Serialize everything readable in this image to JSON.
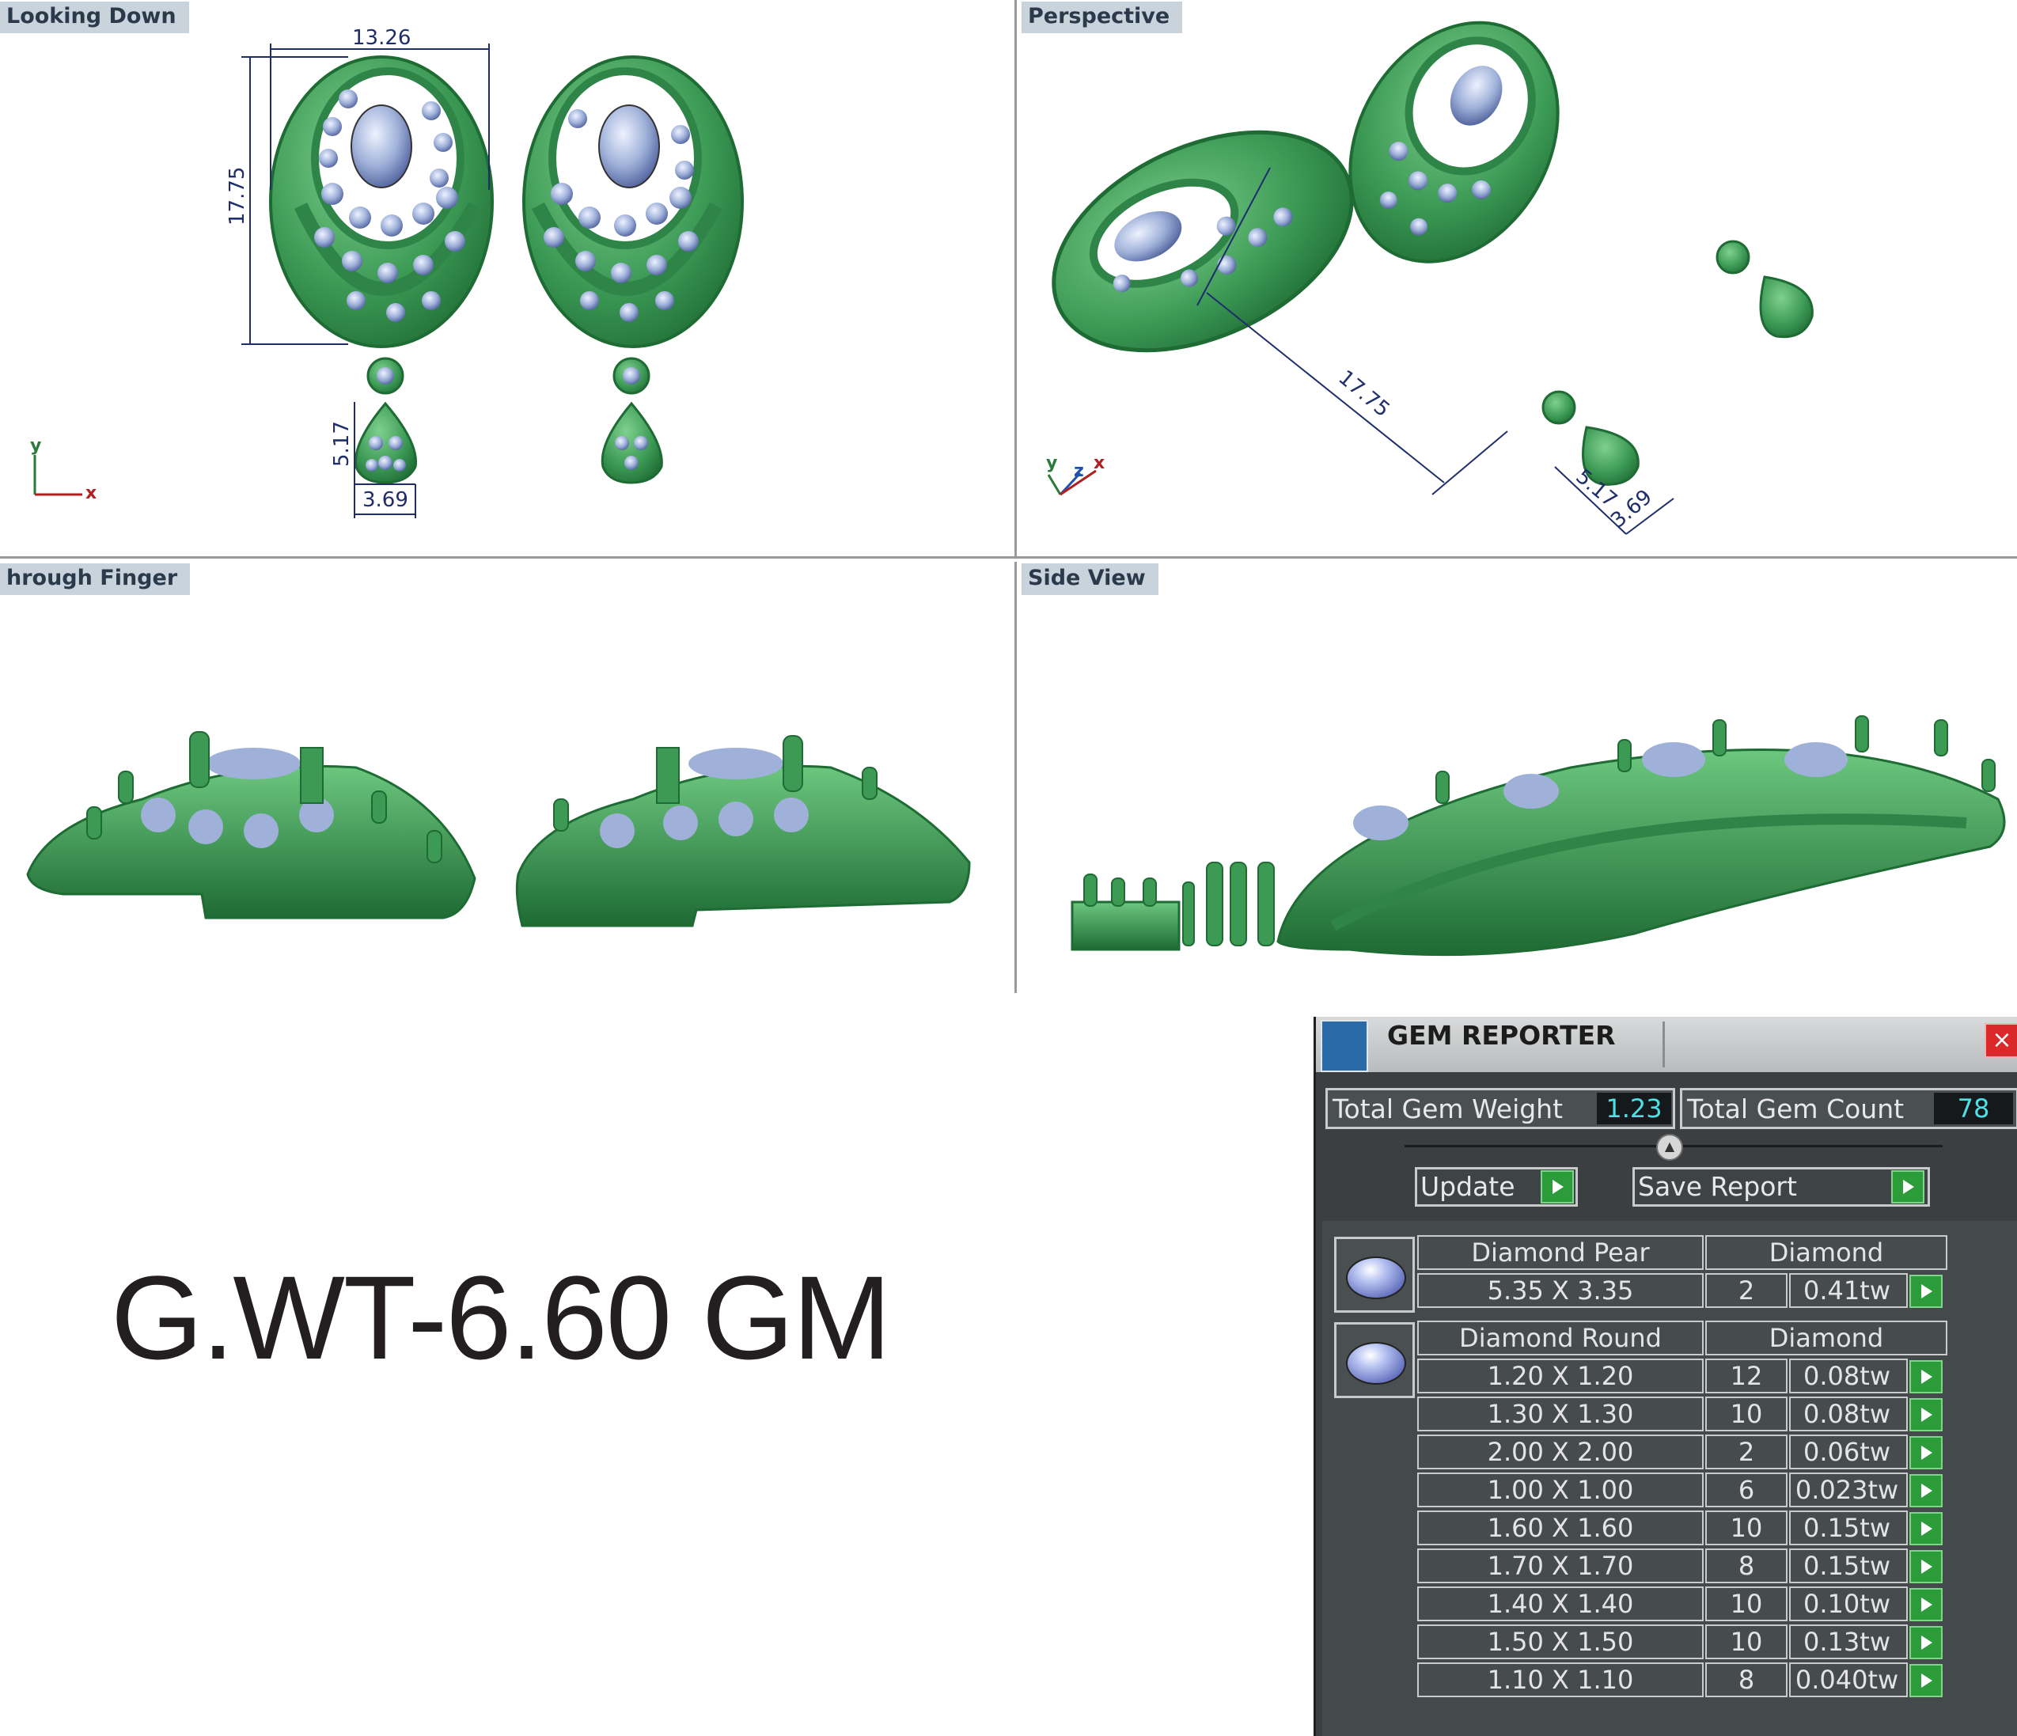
{
  "viewports": {
    "top_left": {
      "label": "Looking Down",
      "dims": {
        "width": "13.26",
        "height": "17.75",
        "drop_height": "5.17",
        "drop_width": "3.69"
      },
      "axes": {
        "y": "y",
        "x": "x"
      }
    },
    "top_right": {
      "label": "Perspective",
      "dims": {
        "length": "17.75",
        "drop_height": "5.17",
        "drop_width": "3.69"
      },
      "axes": {
        "y": "y",
        "z": "z",
        "x": "x"
      }
    },
    "bottom_left": {
      "label": "hrough Finger"
    },
    "bottom_right": {
      "label": "Side View"
    }
  },
  "gross_weight": "G.WT-6.60 GM",
  "gem_reporter": {
    "title": "GEM REPORTER",
    "close_label": "×",
    "total_weight_label": "Total Gem Weight",
    "total_weight_value": "1.23",
    "total_count_label": "Total Gem Count",
    "total_count_value": "78",
    "update_label": "Update",
    "save_report_label": "Save Report",
    "groups": [
      {
        "name": "Diamond Pear",
        "type": "Diamond",
        "rows": [
          {
            "size": "5.35 X 3.35",
            "count": "2",
            "weight": "0.41tw"
          }
        ]
      },
      {
        "name": "Diamond Round",
        "type": "Diamond",
        "rows": [
          {
            "size": "1.20 X 1.20",
            "count": "12",
            "weight": "0.08tw"
          },
          {
            "size": "1.30 X 1.30",
            "count": "10",
            "weight": "0.08tw"
          },
          {
            "size": "2.00 X 2.00",
            "count": "2",
            "weight": "0.06tw"
          },
          {
            "size": "1.00 X 1.00",
            "count": "6",
            "weight": "0.023tw"
          },
          {
            "size": "1.60 X 1.60",
            "count": "10",
            "weight": "0.15tw"
          },
          {
            "size": "1.70 X 1.70",
            "count": "8",
            "weight": "0.15tw"
          },
          {
            "size": "1.40 X 1.40",
            "count": "10",
            "weight": "0.10tw"
          },
          {
            "size": "1.50 X 1.50",
            "count": "10",
            "weight": "0.13tw"
          },
          {
            "size": "1.10 X 1.10",
            "count": "8",
            "weight": "0.040tw"
          }
        ]
      }
    ]
  },
  "colors": {
    "metal": "#3c9a55",
    "metal_dark": "#1e6b34",
    "gem": "#9fb1d9",
    "dimension": "#1f2d6b"
  }
}
